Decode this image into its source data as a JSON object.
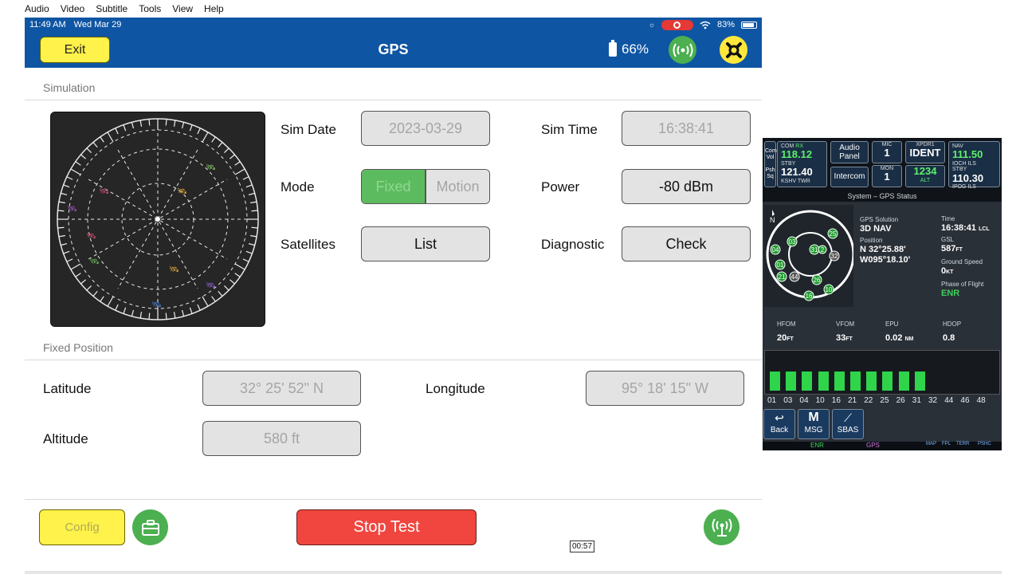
{
  "menubar": {
    "items": [
      "Audio",
      "Video",
      "Subtitle",
      "Tools",
      "View",
      "Help"
    ]
  },
  "statusbar": {
    "time": "11:49 AM",
    "date": "Wed Mar 29",
    "battery": "83%"
  },
  "header": {
    "exit_label": "Exit",
    "title": "GPS",
    "battery_pct": "66%"
  },
  "simulation": {
    "section_label": "Simulation",
    "sim_date_label": "Sim Date",
    "sim_date": "2023-03-29",
    "sim_time_label": "Sim Time",
    "sim_time": "16:38:41",
    "mode_label": "Mode",
    "mode_fixed": "Fixed",
    "mode_motion": "Motion",
    "power_label": "Power",
    "power": "-80 dBm",
    "satellites_label": "Satellites",
    "satellites_button": "List",
    "diagnostic_label": "Diagnostic",
    "diagnostic_button": "Check"
  },
  "fixed_position": {
    "section_label": "Fixed Position",
    "latitude_label": "Latitude",
    "latitude": "32° 25' 52\" N",
    "longitude_label": "Longitude",
    "longitude": "95° 18' 15\" W",
    "altitude_label": "Altitude",
    "altitude": "580 ft"
  },
  "footer": {
    "config_label": "Config",
    "stop_label": "Stop Test"
  },
  "timestamp": "00:57",
  "colors": {
    "header_blue": "#0e55a3",
    "active_green": "#5dbb5f",
    "stop_red": "#f0463f",
    "yellow": "#fff24a"
  },
  "garmin": {
    "com_label": "COM",
    "rx": "RX",
    "com_active": "118.12",
    "stby": "STBY",
    "com_standby": "121.40",
    "com_standby_id": "KSHV TWR",
    "com_vol": "Com Vol",
    "psh_sq": "Psh Sq",
    "audio_panel": "Audio Panel",
    "intercom": "Intercom",
    "mic": "MIC",
    "mic_val": "1",
    "mon": "MON",
    "mon_val": "1",
    "xpdr": "XPDR1",
    "ident": "IDENT",
    "squawk": "1234",
    "alt": "ALT",
    "nav_label": "NAV",
    "nav_active": "111.50",
    "nav_active_id": "IOCH ILS",
    "nav_stby": "STBY",
    "nav_standby": "110.30",
    "nav_standby_id": "IPOG ILS",
    "page_title": "System – GPS Status",
    "north": "N",
    "solution_label": "GPS Solution",
    "solution": "3D NAV",
    "position_label": "Position",
    "lat": "N 32°25.88'",
    "lon": "W095°18.10'",
    "time_label": "Time",
    "time": "16:38:41",
    "time_suffix": "LCL",
    "gsl_label": "GSL",
    "gsl": "587",
    "gsl_unit": "FT",
    "gs_label": "Ground Speed",
    "gs": "0",
    "gs_unit": "KT",
    "phase_label": "Phase of Flight",
    "phase": "ENR",
    "hfom_label": "HFOM",
    "hfom": "20",
    "hfom_unit": "FT",
    "vfom_label": "VFOM",
    "vfom": "33",
    "vfom_unit": "FT",
    "epu_label": "EPU",
    "epu": "0.02",
    "epu_unit": "NM",
    "hdop_label": "HDOP",
    "hdop": "0.8",
    "sat_prns": [
      "01",
      "03",
      "04",
      "10",
      "16",
      "21",
      "22",
      "25",
      "26",
      "31",
      "32",
      "44",
      "46",
      "48"
    ],
    "sat_strength": [
      0.6,
      0.6,
      0.6,
      0.6,
      0.6,
      0.6,
      0.6,
      0.6,
      0.6,
      0.6,
      0,
      0,
      0,
      0
    ],
    "radar_sats": [
      "25",
      "03",
      "04",
      "31",
      "32",
      "01",
      "21",
      "44",
      "26",
      "16",
      "10",
      "2"
    ],
    "back_label": "Back",
    "msg_label": "MSG",
    "sbas_label": "SBAS",
    "tab_enr": "ENR",
    "tab_gps": "GPS",
    "tab_right": [
      "MAP",
      "FPL",
      "TERR",
      "PSHC"
    ]
  }
}
